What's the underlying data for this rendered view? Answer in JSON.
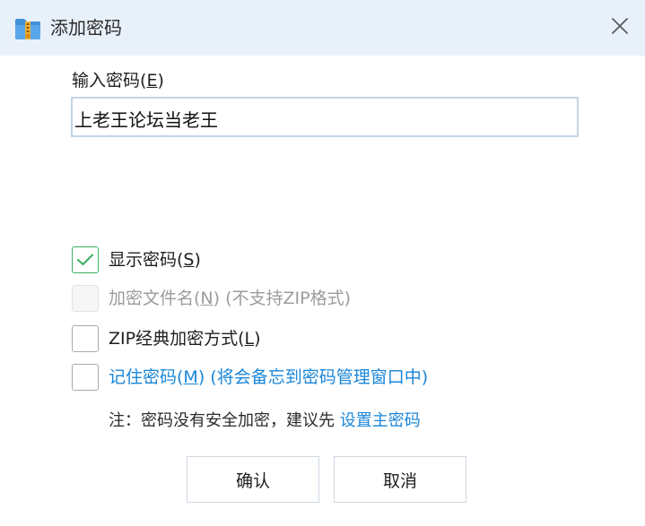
{
  "window": {
    "title": "添加密码",
    "app_icon": "archive-app-icon",
    "close_icon": "close-icon"
  },
  "password": {
    "label": "输入密码",
    "label_hotkey_prefix": "(",
    "label_hotkey": "E",
    "label_hotkey_suffix": ")",
    "value": "上老王论坛当老王"
  },
  "options": [
    {
      "text_before": "显示密码(",
      "hotkey": "S",
      "text_after": ")",
      "checked": true,
      "disabled": false
    },
    {
      "text_before": "加密文件名(",
      "hotkey": "N",
      "text_after": ") (不支持ZIP格式)",
      "checked": false,
      "disabled": true
    },
    {
      "text_before": "ZIP经典加密方式(",
      "hotkey": "L",
      "text_after": ")",
      "checked": false,
      "disabled": false
    },
    {
      "text_before": "记住密码(",
      "hotkey": "M",
      "text_after": ") (将会备忘到密码管理窗口中)",
      "checked": false,
      "disabled": false
    }
  ],
  "note": {
    "text": "注：密码没有安全加密，建议先 ",
    "link": "设置主密码"
  },
  "buttons": {
    "ok": "确认",
    "cancel": "取消"
  },
  "colors": {
    "titlebar": "#e8f0fa",
    "link": "#1a86d8",
    "check": "#3aae5c"
  }
}
